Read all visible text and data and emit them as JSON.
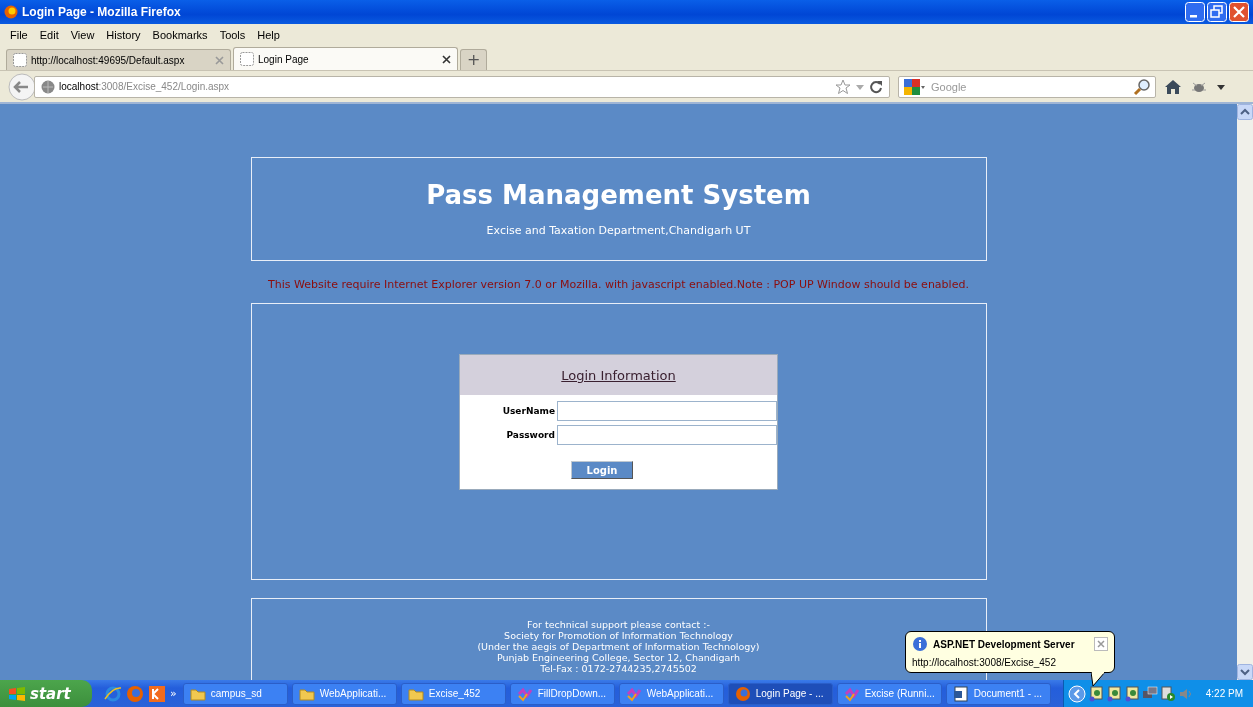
{
  "window": {
    "title": "Login Page - Mozilla Firefox"
  },
  "menu": [
    "File",
    "Edit",
    "View",
    "History",
    "Bookmarks",
    "Tools",
    "Help"
  ],
  "tabs": [
    {
      "label": "http://localhost:49695/Default.aspx",
      "selected": false
    },
    {
      "label": "Login Page",
      "selected": true
    }
  ],
  "new_tab": "+",
  "address": {
    "host": "localhost",
    "path": ":3008/Excise_452/Login.aspx"
  },
  "search": {
    "placeholder": "Google"
  },
  "page": {
    "title": "Pass Management System",
    "subtitle": "Excise and Taxation Department,Chandigarh UT",
    "notice": "This Website require Internet Explorer version 7.0 or Mozilla. with javascript enabled.Note : POP UP Window should be enabled.",
    "login": {
      "heading": "Login Information",
      "fields": [
        {
          "label": "UserName"
        },
        {
          "label": "Password"
        }
      ],
      "button": "Login"
    },
    "footer": [
      "For technical support please contact :-",
      "Society for Promotion of Information Technology",
      "(Under the aegis of Department of Information Technology)",
      "Punjab Engineering College, Sector 12, Chandigarh",
      "Tel-Fax : 0172-2744235,2745502"
    ]
  },
  "notification": {
    "title": "ASP.NET Development Server",
    "url": "http://localhost:3008/Excise_452"
  },
  "taskbar": {
    "start": "start",
    "chevron": "»",
    "tasks": [
      {
        "label": "campus_sd",
        "kind": "folder",
        "selected": false
      },
      {
        "label": "WebApplicati...",
        "kind": "folder",
        "selected": false
      },
      {
        "label": "Excise_452",
        "kind": "folder",
        "selected": false
      },
      {
        "label": "FillDropDown...",
        "kind": "studio",
        "selected": false
      },
      {
        "label": "WebApplicati...",
        "kind": "studio",
        "selected": false
      },
      {
        "label": "Login Page - ...",
        "kind": "browser",
        "selected": true
      },
      {
        "label": "Excise (Runni...",
        "kind": "studio",
        "selected": false
      },
      {
        "label": "Document1 - ...",
        "kind": "document",
        "selected": false
      }
    ],
    "time": "4:22 PM"
  }
}
